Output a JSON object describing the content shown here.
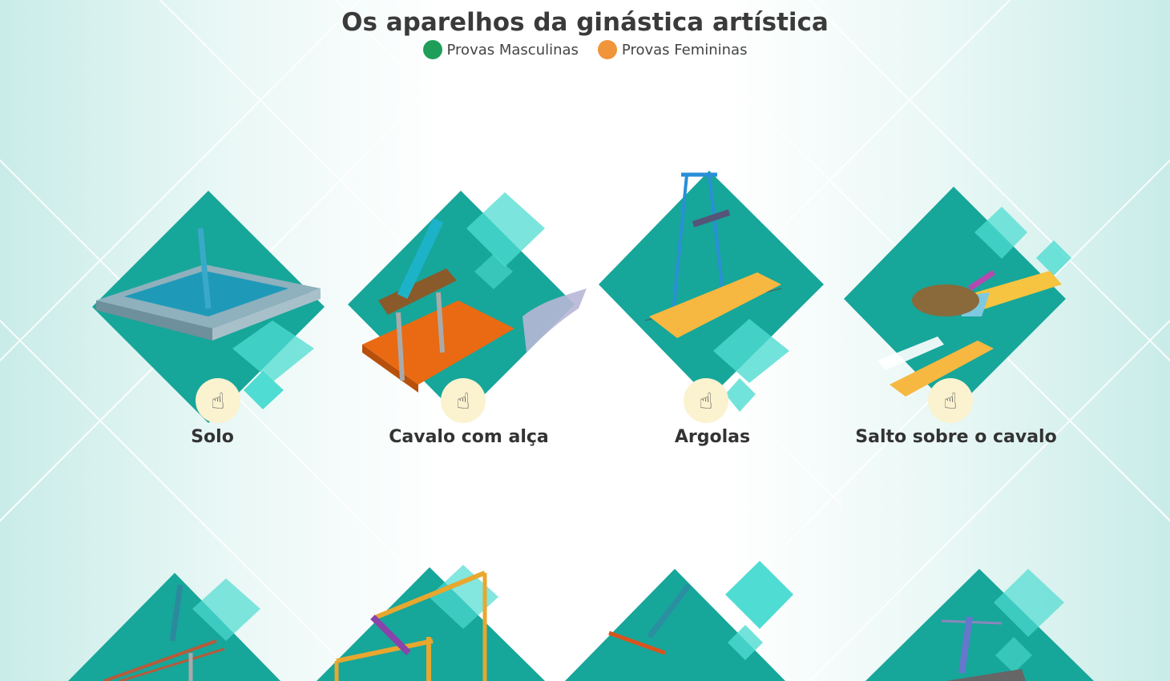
{
  "title": "Os aparelhos da ginástica artística",
  "legend": [
    {
      "label": "Provas Masculinas",
      "color": "#1f9e5a"
    },
    {
      "label": "Provas Femininas",
      "color": "#f0953a"
    }
  ],
  "colors": {
    "diamond": "#17a69a",
    "accent": "#4fdcd2",
    "hand_bg": "#fbf2cf"
  },
  "apparatus": [
    {
      "name": "Solo",
      "icon": "tap-hand-icon"
    },
    {
      "name": "Cavalo com alça",
      "icon": "tap-hand-icon"
    },
    {
      "name": "Argolas",
      "icon": "tap-hand-icon"
    },
    {
      "name": "Salto sobre o cavalo",
      "icon": "tap-hand-icon"
    }
  ]
}
